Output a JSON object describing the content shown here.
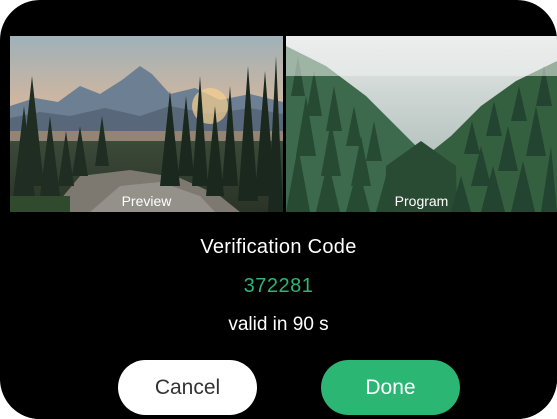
{
  "colors": {
    "background": "#000000",
    "accent": "#2bb673",
    "text": "#ffffff",
    "cancel_button_bg": "#ffffff",
    "cancel_button_text": "#333333"
  },
  "previews": {
    "preview_label": "Preview",
    "program_label": "Program"
  },
  "dialog": {
    "title": "Verification Code",
    "code": "372281",
    "validity": "valid in 90 s",
    "cancel_label": "Cancel",
    "done_label": "Done"
  }
}
